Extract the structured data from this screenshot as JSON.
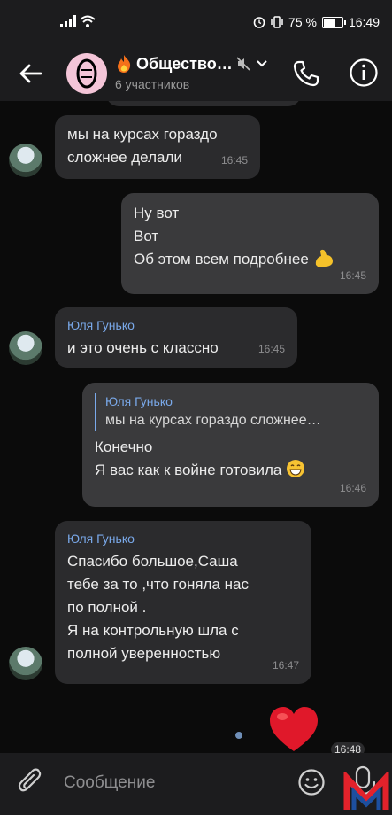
{
  "status_bar": {
    "battery": "75 %",
    "time": "16:49",
    "battery_fraction": 0.75
  },
  "header": {
    "title": "Общество…",
    "subtitle": "6 участников"
  },
  "messages": [
    {
      "text_lines": [
        "мы на курсах гораздо",
        "сложнее делали"
      ],
      "time": "16:45"
    },
    {
      "text_lines": [
        "Ну вот",
        "Вот",
        "Об этом всем подробнее"
      ],
      "time": "16:45"
    },
    {
      "sender": "Юля Гунько",
      "text_lines": [
        "и это очень с классно"
      ],
      "time": "16:45"
    },
    {
      "reply_sender": "Юля Гунько",
      "reply_text": "мы на курсах гораздо сложнее…",
      "text_lines": [
        "Конечно",
        "Я вас как к войне готовила"
      ],
      "time": "16:46"
    },
    {
      "sender": "Юля Гунько",
      "text_lines": [
        "Спасибо большое,Саша",
        "тебе за то ,что гоняла нас",
        "по полной .",
        "Я на контрольную шла с",
        "полной уверенностью"
      ],
      "time": "16:47"
    },
    {
      "time": "16:48"
    }
  ],
  "composer": {
    "placeholder": "Сообщение"
  },
  "colors": {
    "accent": "#7aa9ea",
    "bubble_in": "#2b2b2d",
    "bubble_out": "#3a3a3c",
    "background": "#0b0b0b"
  }
}
